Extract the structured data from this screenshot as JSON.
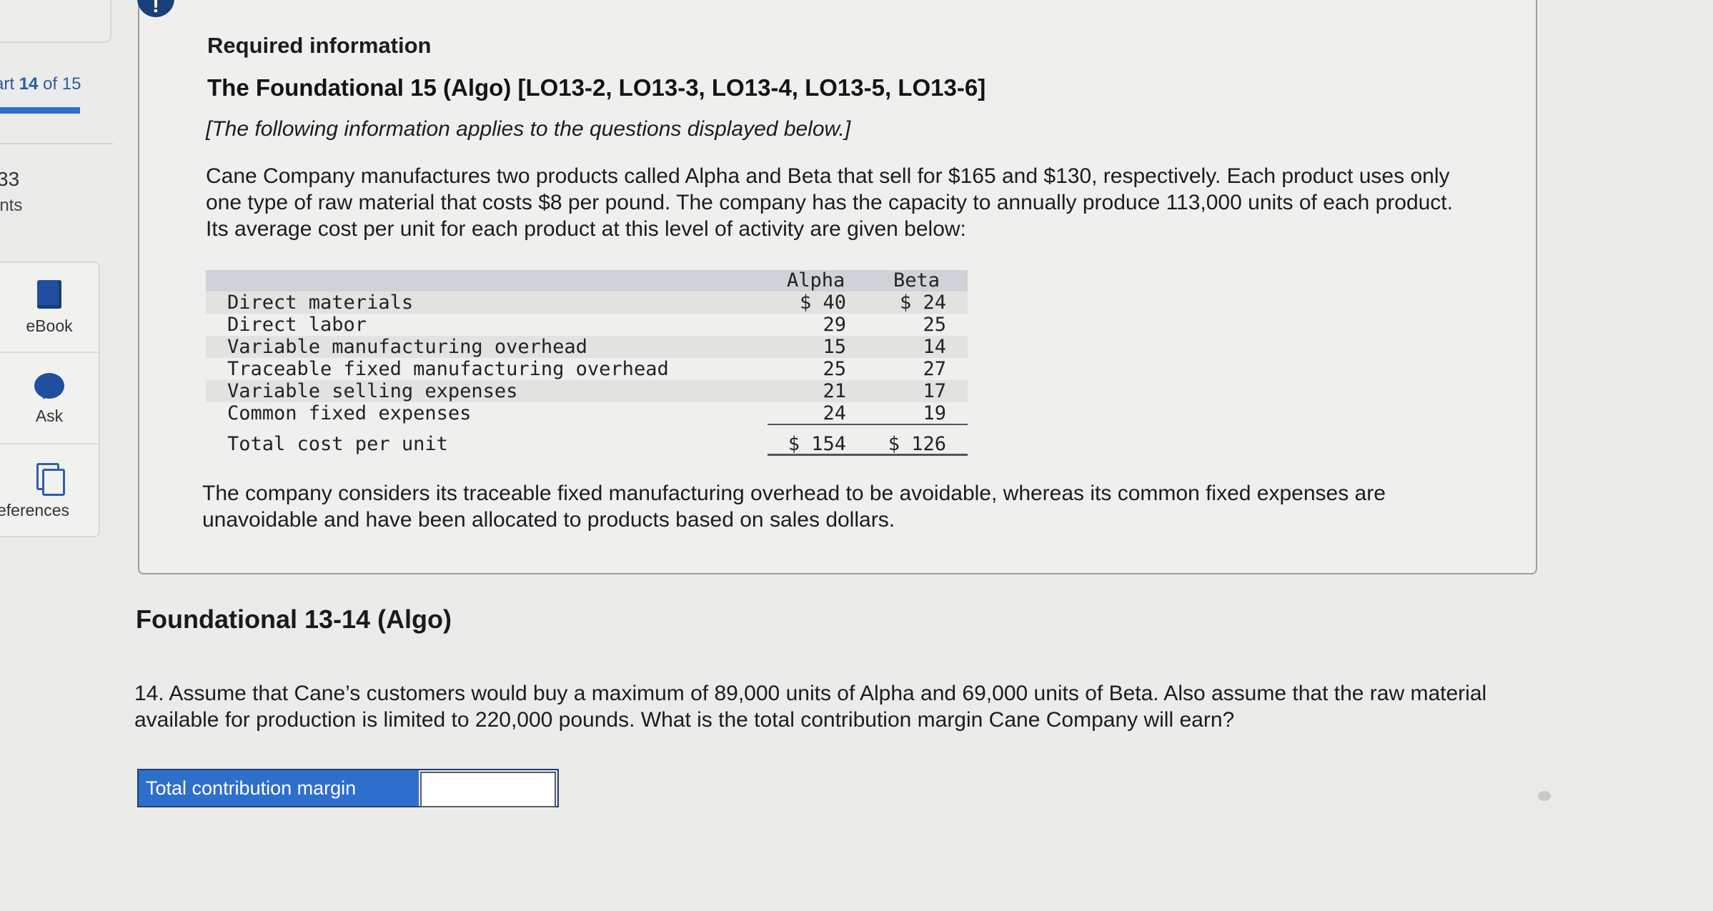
{
  "sidebar": {
    "part": {
      "prefix": "art ",
      "current": "14",
      "of_text": " of 15"
    },
    "points": {
      "value": "33",
      "label": "ints"
    },
    "tools": [
      {
        "label": "eBook",
        "icon": "ebook-icon"
      },
      {
        "label": "Ask",
        "icon": "ask-icon"
      },
      {
        "label": "eferences",
        "icon": "references-icon"
      }
    ]
  },
  "alert": {
    "symbol": "!"
  },
  "info": {
    "heading": "Required information",
    "title": "The Foundational 15 (Algo) [LO13-2, LO13-3, LO13-4, LO13-5, LO13-6]",
    "note": "[The following information applies to the questions displayed below.]",
    "paragraph": "Cane Company manufactures two products called Alpha and Beta that sell for $165 and $130, respectively. Each product uses only one type of raw material that costs $8 per pound. The company has the capacity to annually produce 113,000 units of each product. Its average cost per unit for each product at this level of activity are given below:",
    "paragraph2": "The company considers its traceable fixed manufacturing overhead to be avoidable, whereas its common fixed expenses are unavoidable and have been allocated to products based on sales dollars."
  },
  "cost_table": {
    "columns": [
      "Alpha",
      "Beta"
    ],
    "rows": [
      {
        "label": "Direct materials",
        "alpha": "$ 40",
        "beta": "$ 24"
      },
      {
        "label": "Direct labor",
        "alpha": "29",
        "beta": "25"
      },
      {
        "label": "Variable manufacturing overhead",
        "alpha": "15",
        "beta": "14"
      },
      {
        "label": "Traceable fixed manufacturing overhead",
        "alpha": "25",
        "beta": "27"
      },
      {
        "label": "Variable selling expenses",
        "alpha": "21",
        "beta": "17"
      },
      {
        "label": "Common fixed expenses",
        "alpha": "24",
        "beta": "19"
      }
    ],
    "total": {
      "label": "Total cost per unit",
      "alpha": "$ 154",
      "beta": "$ 126"
    }
  },
  "question": {
    "title": "Foundational 13-14 (Algo)",
    "text": "14. Assume that Cane’s customers would buy a maximum of 89,000 units of Alpha and 69,000 units of Beta. Also assume that the raw material available for production is limited to 220,000 pounds. What is the total contribution margin Cane Company will earn?",
    "answer_label": "Total contribution margin",
    "answer_value": ""
  },
  "colors": {
    "accent": "#2f6fcc",
    "progress": "#2f6ed1",
    "badge": "#1b3f7a"
  }
}
